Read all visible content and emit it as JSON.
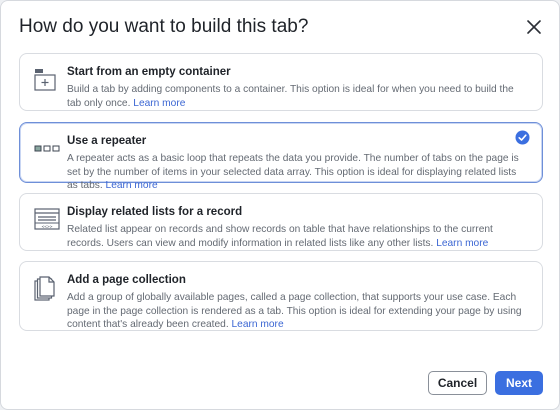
{
  "dialog": {
    "title": "How do you want to build this tab?"
  },
  "options": [
    {
      "title": "Start from an empty container",
      "description": "Build a tab by adding components to a container. This option is ideal for when you need to build the tab only once.",
      "link": "Learn more",
      "icon": "empty-container-icon",
      "selected": false
    },
    {
      "title": "Use a repeater",
      "description": "A repeater acts as a basic loop that repeats the data you provide. The number of tabs on the page is set by the number of items in your selected data array. This option is ideal for displaying related lists as tabs.",
      "link": "Learn more",
      "icon": "repeater-icon",
      "selected": true
    },
    {
      "title": "Display related lists for a record",
      "description": "Related list appear on records and show records on table that have relationships to the current records. Users can view and modify information in related lists like any other lists.",
      "link": "Learn more",
      "icon": "related-list-icon",
      "selected": false
    },
    {
      "title": "Add a page collection",
      "description": "Add a group of globally available pages, called a page collection, that supports your use case. Each page in the page collection is rendered as a tab. This option is ideal for extending your page by using content that's already been created.",
      "link": "Learn more",
      "icon": "page-collection-icon",
      "selected": false
    }
  ],
  "footer": {
    "cancel_label": "Cancel",
    "next_label": "Next"
  },
  "colors": {
    "accent": "#3b6fe0",
    "link": "#3b66d3",
    "selected_border": "#6e8fd8"
  }
}
